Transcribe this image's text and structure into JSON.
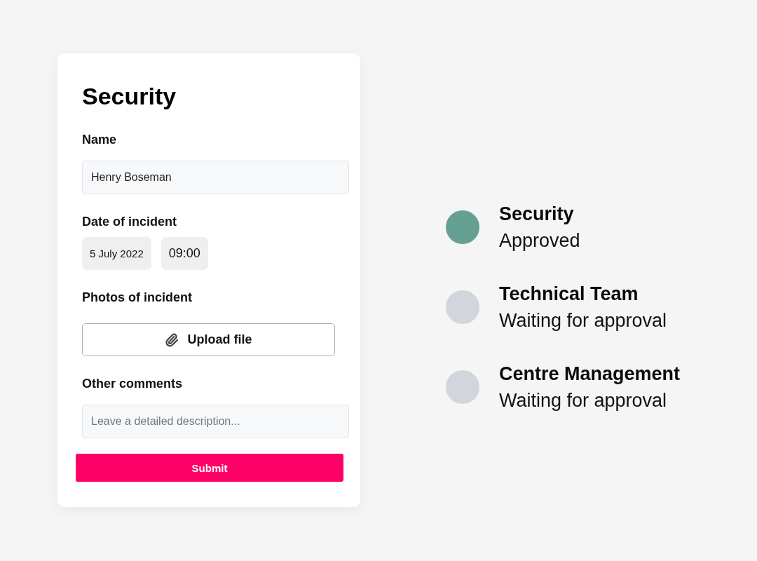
{
  "form": {
    "title": "Security",
    "fields": [
      {
        "kind": "text",
        "label": "Name",
        "value": "Henry Boseman"
      },
      {
        "kind": "datetime",
        "label": "Date of incident",
        "date": "5 July 2022",
        "time": "09:00"
      },
      {
        "kind": "upload",
        "label": "Photos of incident",
        "button": "Upload file"
      },
      {
        "kind": "textarea",
        "label": "Other comments",
        "placeholder": "Leave a detailed description..."
      }
    ],
    "submit": "Submit"
  },
  "approvals": [
    {
      "team": "Security",
      "status": "Approved",
      "color": "#66a092"
    },
    {
      "team": "Technical Team",
      "status": "Waiting for approval",
      "color": "#d3d5dc"
    },
    {
      "team": "Centre Management",
      "status": "Waiting for approval",
      "color": "#d3d5dc"
    }
  ]
}
